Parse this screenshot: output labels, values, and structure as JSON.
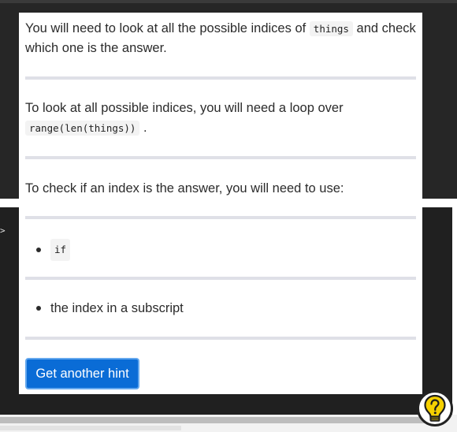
{
  "hints": {
    "hint1": {
      "before": "You will need to look at all the possible indices of ",
      "code": "things",
      "after": " and check which one is the answer."
    },
    "hint2": {
      "before": "To look at all possible indices, you will need a loop over ",
      "code": "range(len(things))",
      "after": " ."
    },
    "hint3": {
      "text": "To check if an index is the answer, you will need to use:"
    },
    "bullets": [
      {
        "code": "if"
      },
      {
        "text": "the index in a subscript"
      }
    ]
  },
  "button": {
    "label": "Get another hint"
  },
  "terminal": {
    "prompt_glyph": ">"
  },
  "icons": {
    "hint_toggle": "lightbulb-question-icon"
  },
  "colors": {
    "button_bg": "#0a6cd6",
    "bulb_yellow": "#f5d000",
    "terminal_bg": "#202020"
  }
}
